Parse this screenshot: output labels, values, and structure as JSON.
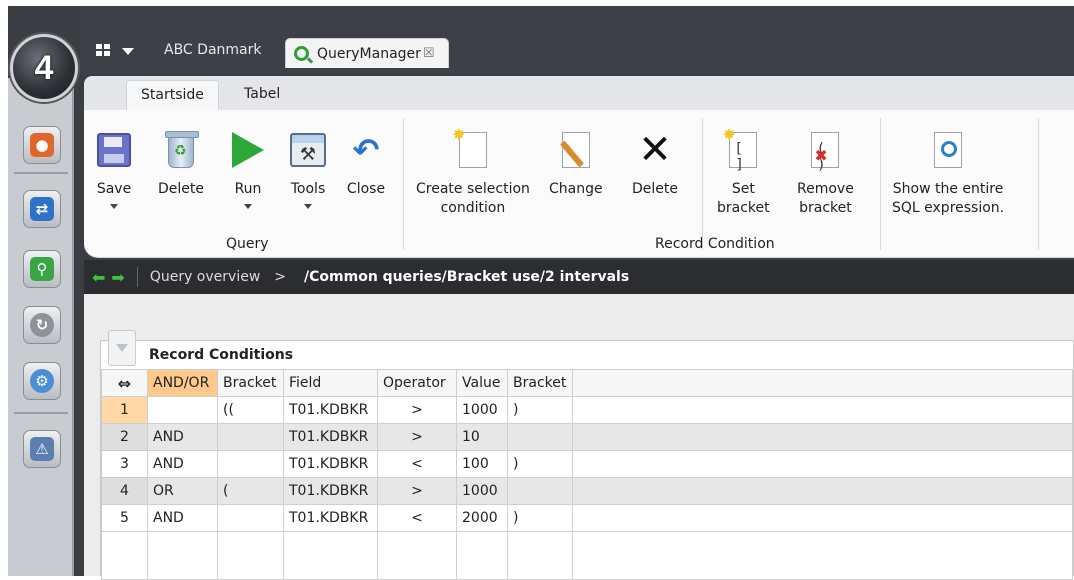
{
  "app": {
    "logo_text": "4",
    "workspace_tab": "ABC Danmark",
    "module_tab": {
      "label": "QueryManager",
      "close": "☒"
    }
  },
  "ribbon": {
    "tabs": [
      "Startside",
      "Tabel"
    ],
    "buttons": {
      "save": "Save",
      "delete": "Delete",
      "run": "Run",
      "tools": "Tools",
      "close": "Close",
      "create_selection_line1": "Create selection",
      "create_selection_line2": "condition",
      "change": "Change",
      "delete_condition": "Delete",
      "set_bracket_line1": "Set",
      "set_bracket_line2": "bracket",
      "remove_bracket_line1": "Remove",
      "remove_bracket_line2": "bracket",
      "show_sql_line1": "Show the entire",
      "show_sql_line2": "SQL expression."
    },
    "groups": {
      "query": "Query",
      "record_condition": "Record Condition"
    }
  },
  "breadcrumb": {
    "overview": "Query overview",
    "separator": ">",
    "path": "/Common queries/Bracket use/2 intervals"
  },
  "panel": {
    "title": "Record Conditions",
    "columns": [
      "AND/OR",
      "Bracket",
      "Field",
      "Operator",
      "Value",
      "Bracket"
    ],
    "rows": [
      {
        "n": "1",
        "andor": "",
        "open": "((",
        "field": "T01.KDBKR",
        "op": ">",
        "value": "1000",
        "close": ")"
      },
      {
        "n": "2",
        "andor": "AND",
        "open": "",
        "field": "T01.KDBKR",
        "op": ">",
        "value": "10",
        "close": ""
      },
      {
        "n": "3",
        "andor": "AND",
        "open": "",
        "field": "T01.KDBKR",
        "op": "<",
        "value": "100",
        "close": ")"
      },
      {
        "n": "4",
        "andor": "OR",
        "open": "(",
        "field": "T01.KDBKR",
        "op": ">",
        "value": "1000",
        "close": ""
      },
      {
        "n": "5",
        "andor": "AND",
        "open": "",
        "field": "T01.KDBKR",
        "op": "<",
        "value": "2000",
        "close": ")"
      }
    ]
  },
  "colors": {
    "accent_selected": "#ffc98c",
    "run_green": "#2fa83a",
    "nav_green": "#3ec13e"
  }
}
